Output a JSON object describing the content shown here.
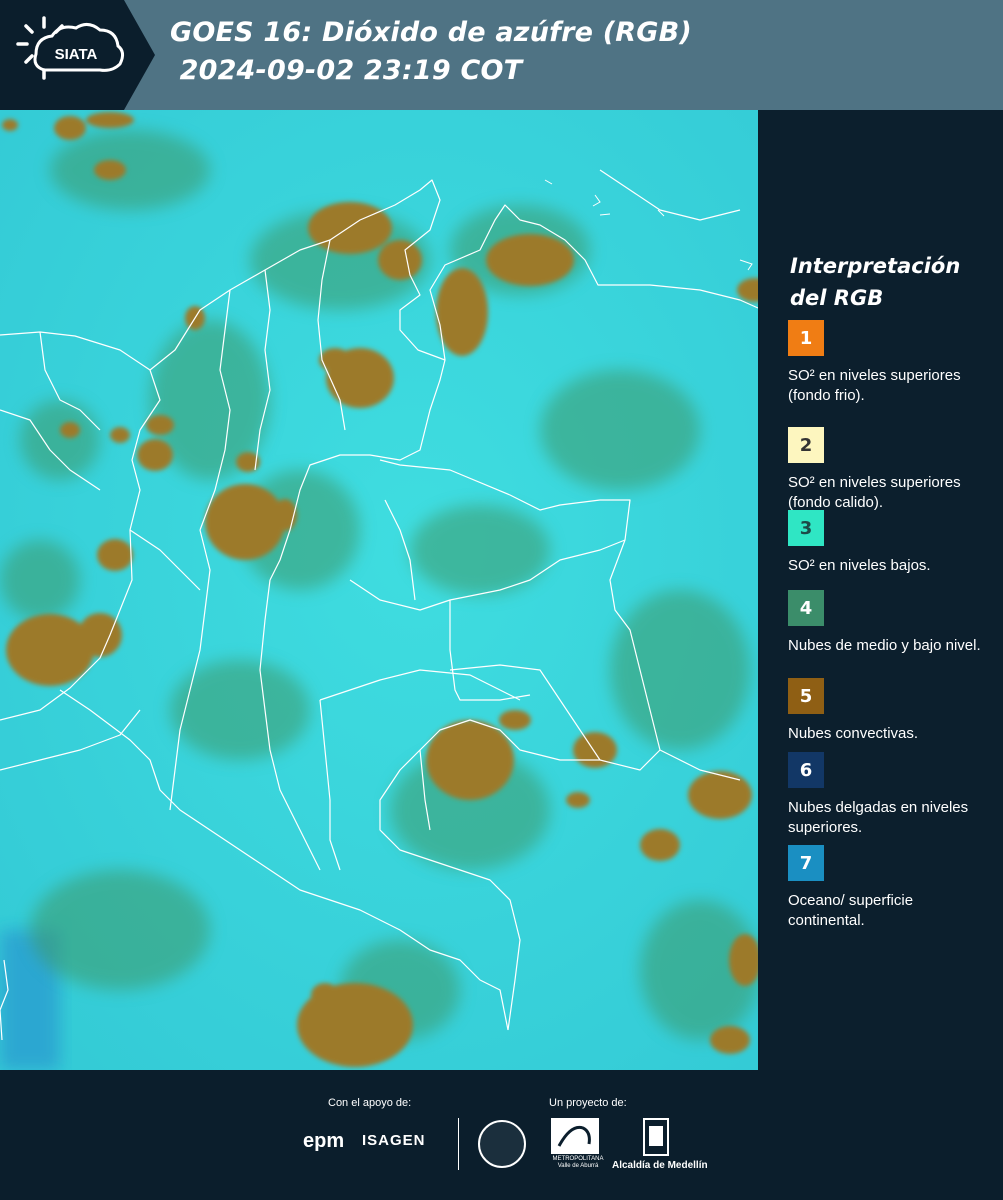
{
  "header": {
    "logo_text": "SIATA",
    "title_line1": "GOES 16: Dióxido de azúfre (RGB)",
    "title_line2": " 2024-09-02 23:19 COT"
  },
  "map": {
    "background_color": "#3fd8dd",
    "convective_color": "#9c7a2c",
    "midlevel_cloud_color": "#3e9a6a",
    "border_color": "#ffffff"
  },
  "legend": {
    "title": "Interpretación del RGB",
    "items": [
      {
        "number": "1",
        "color": "#f07d14",
        "text_color": "#ffffff",
        "label": "SO² en niveles superiores (fondo frio)."
      },
      {
        "number": "2",
        "color": "#fdf6bf",
        "text_color": "#333333",
        "label": "SO² en niveles superiores (fondo calido)."
      },
      {
        "number": "3",
        "color": "#2fe6c4",
        "text_color": "#1d4a48",
        "label": "SO² en niveles bajos."
      },
      {
        "number": "4",
        "color": "#3b8d6a",
        "text_color": "#ffffff",
        "label": "Nubes de medio y bajo nivel."
      },
      {
        "number": "5",
        "color": "#8f5f14",
        "text_color": "#ffffff",
        "label": "Nubes convectivas."
      },
      {
        "number": "6",
        "color": "#123766",
        "text_color": "#ffffff",
        "label": "Nubes delgadas en niveles superiores."
      },
      {
        "number": "7",
        "color": "#1a8fc2",
        "text_color": "#ffffff",
        "label": "Oceano/ superficie continental."
      }
    ]
  },
  "footer": {
    "support_label": "Con el apoyo de:",
    "project_label": "Un proyecto de:",
    "sponsor1": "epm",
    "sponsor2": "ISAGEN",
    "area_caption": "METROPOLITANA Valle de Aburrá",
    "alcaldia": "Alcaldía de Medellín"
  }
}
